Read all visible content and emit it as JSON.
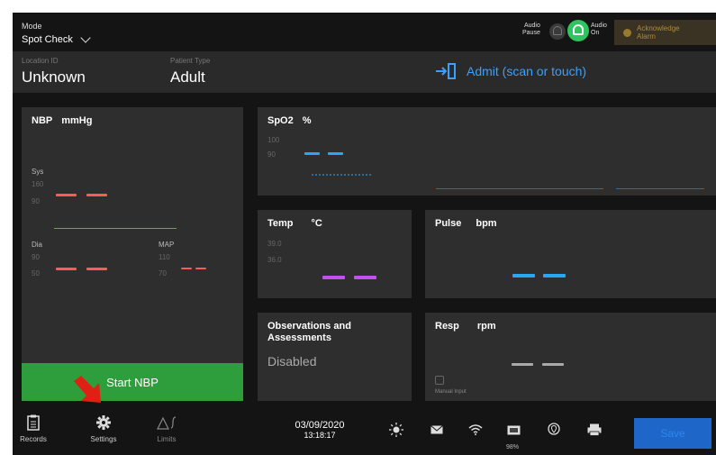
{
  "header": {
    "mode_label": "Mode",
    "mode_value": "Spot Check",
    "audio_pause_line1": "Audio",
    "audio_pause_line2": "Pause",
    "audio_on_line1": "Audio",
    "audio_on_line2": "On",
    "ack_line1": "Acknowledge",
    "ack_line2": "Alarm"
  },
  "patient": {
    "location_label": "Location ID",
    "location_value": "Unknown",
    "type_label": "Patient Type",
    "type_value": "Adult",
    "admit_label": "Admit (scan or touch)"
  },
  "nbp": {
    "title": "NBP",
    "unit": "mmHg",
    "sys_label": "Sys",
    "sys_high": "160",
    "sys_low": "90",
    "dia_label": "Dia",
    "dia_high": "90",
    "dia_low": "50",
    "map_label": "MAP",
    "map_high": "110",
    "map_low": "70",
    "start_label": "Start NBP"
  },
  "spo2": {
    "title": "SpO2",
    "unit": "%",
    "high": "100",
    "low": "90"
  },
  "temp": {
    "title": "Temp",
    "unit": "°C",
    "high": "39.0",
    "low": "36.0"
  },
  "pulse": {
    "title": "Pulse",
    "unit": "bpm"
  },
  "observations": {
    "title_line1": "Observations and",
    "title_line2": "Assessments",
    "status": "Disabled"
  },
  "resp": {
    "title": "Resp",
    "unit": "rpm",
    "manual_label": "Manual Input"
  },
  "bottom": {
    "records_label": "Records",
    "settings_label": "Settings",
    "limits_label": "Limits",
    "date": "03/09/2020",
    "time": "13:18:17",
    "battery_percent": "98%",
    "save_label": "Save"
  },
  "colors": {
    "nbp": "#ff5a5a",
    "spo2": "#2aa7f2",
    "temp": "#c24ff0",
    "pulse": "#2aa7f2",
    "resp": "#aaaaaa",
    "start_button": "#2e9e3c",
    "save_button": "#1f66c9",
    "audio_on": "#2ec45f"
  }
}
